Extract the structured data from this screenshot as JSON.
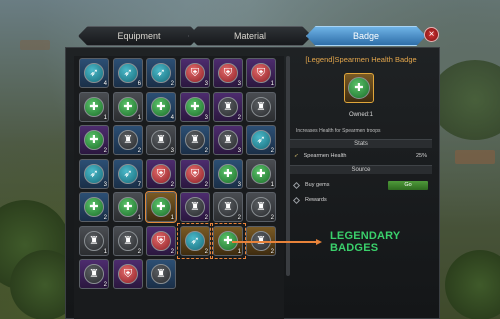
{
  "tabs": [
    {
      "label": "Equipment",
      "active": false
    },
    {
      "label": "Material",
      "active": false
    },
    {
      "label": "Badge",
      "active": true
    }
  ],
  "close_label": "×",
  "grid": {
    "rows": [
      [
        {
          "q": "blue",
          "b": "teal",
          "count": "4"
        },
        {
          "q": "blue",
          "b": "teal",
          "count": "6"
        },
        {
          "q": "blue",
          "b": "teal",
          "count": "2"
        },
        {
          "q": "purple",
          "b": "red",
          "count": "3"
        },
        {
          "q": "purple",
          "b": "red",
          "count": "3"
        },
        {
          "q": "purple",
          "b": "red",
          "count": "1"
        }
      ],
      [
        {
          "q": "gray",
          "b": "green",
          "count": "1"
        },
        {
          "q": "gray",
          "b": "green",
          "count": "1"
        },
        {
          "q": "blue",
          "b": "green",
          "count": "4"
        },
        {
          "q": "purple",
          "b": "green",
          "count": "3"
        },
        {
          "q": "purple",
          "b": "dark",
          "count": "2"
        },
        {
          "q": "gray",
          "b": "dark",
          "count": ""
        }
      ],
      [
        {
          "q": "purple",
          "b": "green",
          "count": "2"
        },
        {
          "q": "blue",
          "b": "dark",
          "count": "2"
        },
        {
          "q": "gray",
          "b": "dark",
          "count": "3"
        },
        {
          "q": "blue",
          "b": "dark",
          "count": "2"
        },
        {
          "q": "purple",
          "b": "dark",
          "count": "3"
        },
        {
          "q": "blue",
          "b": "teal",
          "count": "2"
        }
      ],
      [
        {
          "q": "blue",
          "b": "teal",
          "count": "3"
        },
        {
          "q": "blue",
          "b": "teal",
          "count": "7"
        },
        {
          "q": "purple",
          "b": "red",
          "count": "2"
        },
        {
          "q": "purple",
          "b": "red",
          "count": "2"
        },
        {
          "q": "blue",
          "b": "green",
          "count": "3"
        },
        {
          "q": "gray",
          "b": "green",
          "count": "1"
        }
      ],
      [
        {
          "q": "blue",
          "b": "green",
          "count": "2"
        },
        {
          "q": "gray",
          "b": "green",
          "count": "1"
        },
        {
          "q": "gold",
          "b": "green",
          "count": "1",
          "selected": true
        },
        {
          "q": "purple",
          "b": "dark",
          "count": "2"
        },
        {
          "q": "gray",
          "b": "dark",
          "count": "2"
        },
        {
          "q": "gray",
          "b": "dark",
          "count": "2"
        }
      ],
      [
        {
          "q": "gray",
          "b": "dark",
          "count": "1"
        },
        {
          "q": "gray",
          "b": "dark",
          "count": "2"
        },
        {
          "q": "purple",
          "b": "red",
          "count": "2"
        },
        {
          "q": "gold",
          "b": "teal",
          "count": "2",
          "legendary": true
        },
        {
          "q": "gold",
          "b": "green",
          "count": "1",
          "legendary": true
        },
        {
          "q": "gold",
          "b": "dark",
          "count": "2"
        }
      ],
      [
        {
          "q": "purple",
          "b": "dark",
          "count": "2"
        },
        {
          "q": "purple",
          "b": "red",
          "count": ""
        },
        {
          "q": "blue",
          "b": "dark",
          "count": ""
        }
      ]
    ]
  },
  "detail": {
    "title": "[Legend]Spearmen Health Badge",
    "owned": "Owned:1",
    "description": "Increases Health for Spearmen troops",
    "stats_header": "Stats",
    "stat_name": "Spearmen Health",
    "stat_value": "25%",
    "source_header": "Source",
    "source_buy": "Buy gems",
    "go_label": "Go",
    "source_rewards": "Rewards"
  },
  "annotation": {
    "line1": "LEGENDARY",
    "line2": "BADGES",
    "color": "#3ad06b",
    "arrow_color": "#e8833a"
  },
  "icons": {
    "teal": "spear-icon",
    "green": "cross-heal-icon",
    "red": "shield-icon",
    "dark": "tower-icon"
  }
}
